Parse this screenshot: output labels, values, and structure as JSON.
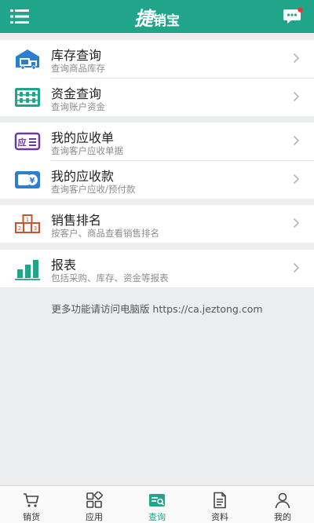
{
  "header": {
    "brand_mark": "捷",
    "brand_text": "销宝",
    "menu_icon": "hamburger-menu-icon",
    "chat_icon": "chat-bubble-icon"
  },
  "groups": [
    {
      "items": [
        {
          "title": "库存查询",
          "subtitle": "查询商品库存",
          "icon": "warehouse-truck-icon"
        },
        {
          "title": "资金查询",
          "subtitle": "查询账户资金",
          "icon": "abacus-icon"
        }
      ]
    },
    {
      "items": [
        {
          "title": "我的应收单",
          "subtitle": "查询客户应收单据",
          "icon": "receivable-document-icon",
          "badge": "应"
        },
        {
          "title": "我的应收款",
          "subtitle": "查询客户应收/预付款",
          "icon": "wallet-yen-icon",
          "badge": "¥"
        }
      ]
    },
    {
      "items": [
        {
          "title": "销售排名",
          "subtitle": "按客户、商品查看销售排名",
          "icon": "ranking-podium-icon",
          "podium": [
            "1",
            "2",
            "3"
          ]
        }
      ]
    },
    {
      "items": [
        {
          "title": "报表",
          "subtitle": "包括采购、库存、资金等报表",
          "icon": "bar-chart-icon"
        }
      ]
    }
  ],
  "footer_note": "更多功能请访问电脑版 https://ca.jeztong.com",
  "tabbar": [
    {
      "label": "销货",
      "icon": "cart-icon",
      "active": false
    },
    {
      "label": "应用",
      "icon": "apps-grid-icon",
      "active": false
    },
    {
      "label": "查询",
      "icon": "query-search-icon",
      "active": true
    },
    {
      "label": "资料",
      "icon": "document-icon",
      "active": false
    },
    {
      "label": "我的",
      "icon": "person-icon",
      "active": false
    }
  ],
  "colors": {
    "brand": "#21a58a",
    "icon_blue": "#2a7fd0",
    "icon_purple": "#6b3aa0",
    "icon_orange": "#c8552e",
    "chevron": "#b5b5b5",
    "notification_dot": "#e53935"
  }
}
